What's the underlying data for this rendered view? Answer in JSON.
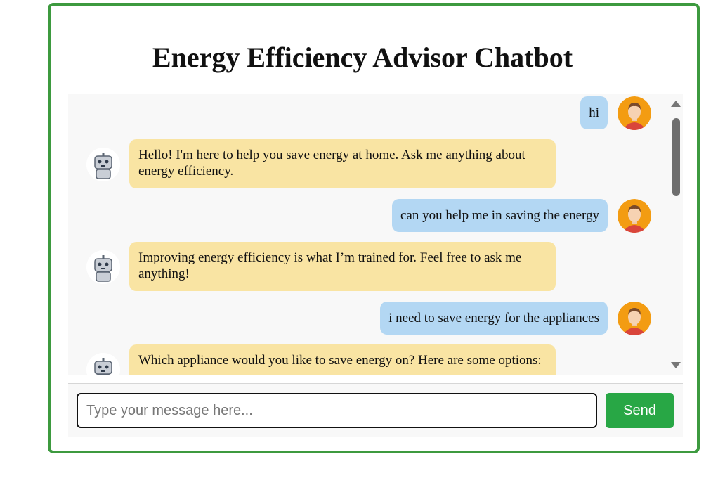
{
  "title": "Energy Efficiency Advisor Chatbot",
  "messages": [
    {
      "role": "user",
      "text": "hi"
    },
    {
      "role": "bot",
      "text": "Hello! I'm here to help you save energy at home. Ask me anything about energy efficiency."
    },
    {
      "role": "user",
      "text": "can you help me in saving the energy"
    },
    {
      "role": "bot",
      "text": "Improving energy efficiency is what I’m trained for. Feel free to ask me anything!"
    },
    {
      "role": "user",
      "text": "i need to save energy for the appliances"
    },
    {
      "role": "bot",
      "text": "Which appliance would you like to save energy on? Here are some options:"
    }
  ],
  "input": {
    "placeholder": "Type your message here...",
    "value": ""
  },
  "send_label": "Send",
  "colors": {
    "border": "#3d9a3f",
    "user_bubble": "#b3d7f3",
    "bot_bubble": "#f9e4a3",
    "send": "#28a745"
  }
}
